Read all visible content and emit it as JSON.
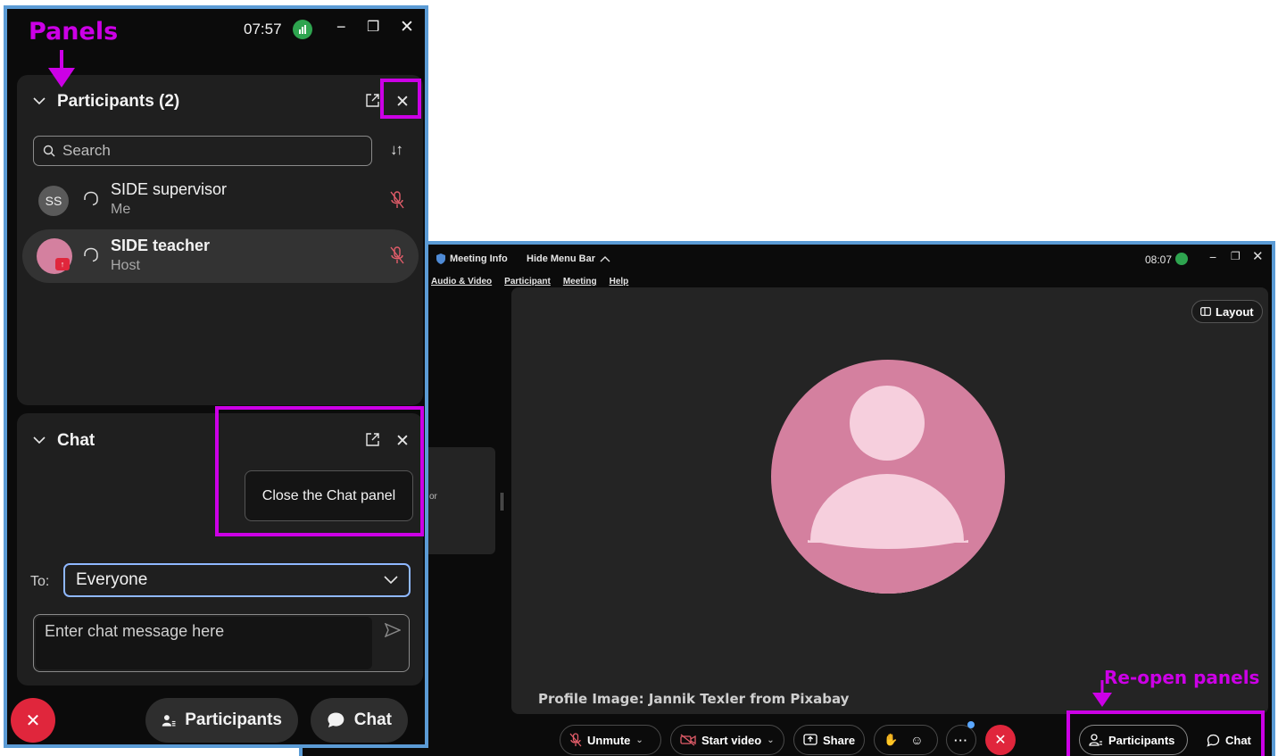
{
  "annotations": {
    "panels_label": "Panels",
    "reopen_label": "Re-open panels",
    "color": "#cc00e6"
  },
  "left_window": {
    "clock": "07:57",
    "participants_panel": {
      "title": "Participants (2)",
      "search_placeholder": "Search",
      "participants": [
        {
          "initials": "SS",
          "name": "SIDE supervisor",
          "role": "Me",
          "muted": true
        },
        {
          "initials": "",
          "name": "SIDE teacher",
          "role": "Host",
          "muted": true
        }
      ]
    },
    "chat_panel": {
      "title": "Chat",
      "tooltip": "Close the Chat panel",
      "to_label": "To:",
      "to_value": "Everyone",
      "message_placeholder": "Enter chat message here"
    },
    "bottom_bar": {
      "participants_label": "Participants",
      "chat_label": "Chat"
    }
  },
  "right_window": {
    "meeting_info": "Meeting Info",
    "hide_menu_bar": "Hide Menu Bar",
    "clock": "08:07",
    "menu": [
      "Audio & Video",
      "Participant",
      "Meeting",
      "Help"
    ],
    "layout_label": "Layout",
    "thumb_text": "or",
    "credit": "Profile Image: Jannik Texler from Pixabay",
    "controls": {
      "unmute": "Unmute",
      "start_video": "Start video",
      "share": "Share",
      "participants": "Participants",
      "chat": "Chat"
    }
  },
  "colors": {
    "avatar_pink": "#d4809f",
    "avatar_light": "#f6cfdd",
    "end_red": "#e0263c",
    "status_green": "#2ea44f",
    "window_border": "#5b9bd5"
  }
}
